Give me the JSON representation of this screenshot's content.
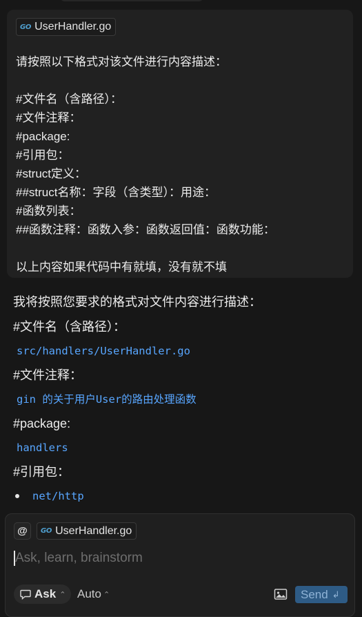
{
  "user_message": {
    "attachment": {
      "name": "UserHandler.go",
      "icon": "go-file-icon"
    },
    "lines": [
      "请按照以下格式对该文件进行内容描述：",
      "",
      "#文件名（含路径）：",
      "#文件注释：",
      "#package:",
      "#引用包：",
      "#struct定义：",
      "##struct名称：字段（含类型）：用途：",
      "#函数列表：",
      "##函数注释：函数入参：函数返回值：函数功能：",
      "",
      "以上内容如果代码中有就填，没有就不填"
    ]
  },
  "assistant_message": {
    "intro": "我将按照您要求的格式对文件内容进行描述：",
    "filename_heading": "#文件名（含路径）：",
    "filename_value": "src/handlers/UserHandler.go",
    "comment_heading": "#文件注释：",
    "comment_value": "gin 的关于用户User的路由处理函数",
    "package_heading": "#package:",
    "package_value": "handlers",
    "imports_heading": "#引用包：",
    "imports": [
      "net/http"
    ]
  },
  "composer": {
    "mention_label": "@",
    "attachment": {
      "name": "UserHandler.go",
      "icon": "go-file-icon"
    },
    "placeholder": "Ask, learn, brainstorm",
    "mode_label": "Ask",
    "model_label": "Auto",
    "send_label": "Send",
    "accent_color": "#2e5b85"
  }
}
